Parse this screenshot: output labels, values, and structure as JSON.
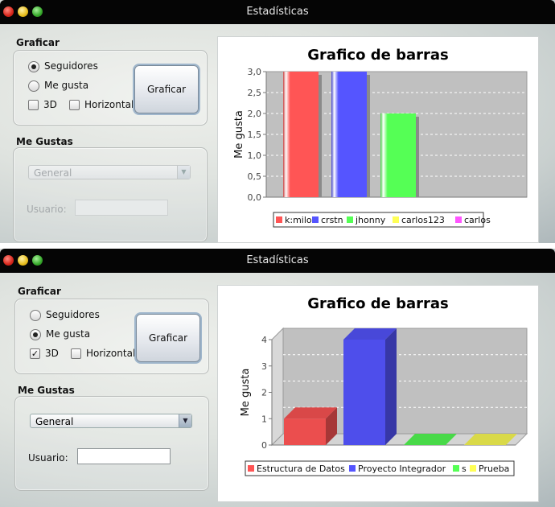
{
  "windows": [
    {
      "title": "Estadísticas",
      "graficar": {
        "section_label": "Graficar",
        "radios": [
          {
            "label": "Seguidores",
            "selected": true
          },
          {
            "label": "Me gusta",
            "selected": false
          }
        ],
        "checks": [
          {
            "label": "3D",
            "checked": false
          },
          {
            "label": "Horizontal",
            "checked": false
          }
        ],
        "button_label": "Graficar"
      },
      "me_gustas": {
        "section_label": "Me Gustas",
        "combo_value": "General",
        "enabled": false,
        "usuario_label": "Usuario:",
        "usuario_value": ""
      },
      "chart_data": {
        "type": "bar",
        "title": "Grafico de barras",
        "ylabel": "Me gusta",
        "xlabel": "",
        "ylim": [
          0,
          3.0
        ],
        "yticks": [
          "0,0",
          "0,5",
          "1,0",
          "1,5",
          "2,0",
          "2,5",
          "3,0"
        ],
        "style": "flat",
        "series": [
          {
            "name": "k:milo",
            "value": 3.0,
            "color": "#ff5555"
          },
          {
            "name": "crstn",
            "value": 3.0,
            "color": "#5555ff"
          },
          {
            "name": "jhonny",
            "value": 2.0,
            "color": "#55ff55"
          },
          {
            "name": "carlos123",
            "value": 0,
            "color": "#ffff55"
          },
          {
            "name": "carlos",
            "value": 0,
            "color": "#ff55ff"
          }
        ],
        "legend": [
          "k:milo",
          "crstn",
          "jhonny",
          "carlos123",
          "carlos"
        ],
        "legend_position": "bottom",
        "grid": true
      }
    },
    {
      "title": "Estadísticas",
      "graficar": {
        "section_label": "Graficar",
        "radios": [
          {
            "label": "Seguidores",
            "selected": false
          },
          {
            "label": "Me gusta",
            "selected": true
          }
        ],
        "checks": [
          {
            "label": "3D",
            "checked": true
          },
          {
            "label": "Horizontal",
            "checked": false
          }
        ],
        "button_label": "Graficar"
      },
      "me_gustas": {
        "section_label": "Me Gustas",
        "combo_value": "General",
        "enabled": true,
        "usuario_label": "Usuario:",
        "usuario_value": ""
      },
      "chart_data": {
        "type": "bar",
        "title": "Grafico de barras",
        "ylabel": "Me gusta",
        "xlabel": "",
        "ylim": [
          0,
          4
        ],
        "yticks": [
          "0",
          "1",
          "2",
          "3",
          "4"
        ],
        "style": "3d",
        "series": [
          {
            "name": "Estructura de Datos",
            "value": 1,
            "color": "#ff5555"
          },
          {
            "name": "Proyecto Integrador",
            "value": 4,
            "color": "#5555ff"
          },
          {
            "name": "s",
            "value": 0,
            "color": "#55ff55"
          },
          {
            "name": "Prueba",
            "value": 0,
            "color": "#ffff55"
          }
        ],
        "legend": [
          "Estructura de Datos",
          "Proyecto Integrador",
          "s",
          "Prueba"
        ],
        "legend_position": "bottom",
        "grid": true
      }
    }
  ],
  "check_mark": "✓",
  "combo_arrow": "▼",
  "colors": {
    "titlebar": "#050505",
    "plot_bg": "#c0c0c0",
    "gridline": "#ffffff"
  }
}
